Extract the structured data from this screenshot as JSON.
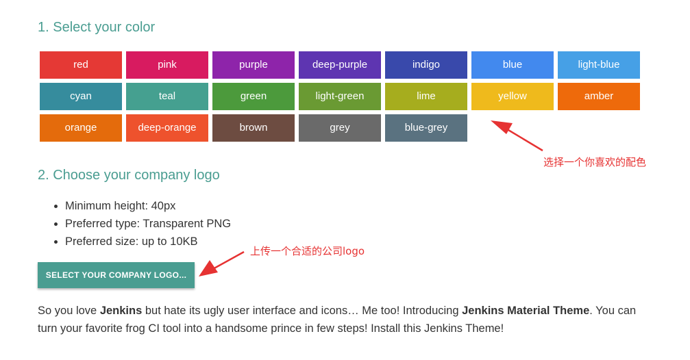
{
  "step1": {
    "title": "1. Select your color"
  },
  "colors": [
    {
      "label": "red",
      "hex": "#e53935"
    },
    {
      "label": "pink",
      "hex": "#d81b60"
    },
    {
      "label": "purple",
      "hex": "#8e24aa"
    },
    {
      "label": "deep-purple",
      "hex": "#5e35b1"
    },
    {
      "label": "indigo",
      "hex": "#3949ab"
    },
    {
      "label": "blue",
      "hex": "#4289ee"
    },
    {
      "label": "light-blue",
      "hex": "#46a0e6"
    },
    {
      "label": "cyan",
      "hex": "#368c9d"
    },
    {
      "label": "teal",
      "hex": "#45a090"
    },
    {
      "label": "green",
      "hex": "#4c9a3c"
    },
    {
      "label": "light-green",
      "hex": "#6a9a33"
    },
    {
      "label": "lime",
      "hex": "#a6ad1e"
    },
    {
      "label": "yellow",
      "hex": "#efba1c"
    },
    {
      "label": "amber",
      "hex": "#ee6a0b"
    },
    {
      "label": "orange",
      "hex": "#e46b0c"
    },
    {
      "label": "deep-orange",
      "hex": "#ee522d"
    },
    {
      "label": "brown",
      "hex": "#6d4c41"
    },
    {
      "label": "grey",
      "hex": "#6a6a6a"
    },
    {
      "label": "blue-grey",
      "hex": "#5a7280"
    }
  ],
  "step2": {
    "title": "2. Choose your company logo",
    "requirements": [
      "Minimum height: 40px",
      "Preferred type: Transparent PNG",
      "Preferred size: up to 10KB"
    ],
    "button_label": "SELECT YOUR COMPANY LOGO..."
  },
  "intro": {
    "part1": "So you love ",
    "bold1": "Jenkins",
    "part2": " but hate its ugly user interface and icons… Me too! Introducing ",
    "bold2": "Jenkins Material Theme",
    "part3": ". You can turn your favorite frog CI tool into a handsome prince in few steps! Install this Jenkins Theme!"
  },
  "annotations": {
    "color_hint": "选择一个你喜欢的配色",
    "logo_hint": "上传一个合适的公司logo",
    "color": "#e63232"
  },
  "theme": {
    "accent": "#4a9d91"
  }
}
